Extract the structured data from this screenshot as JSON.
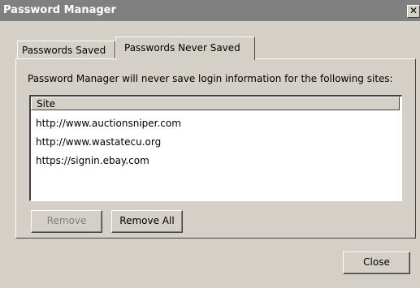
{
  "window": {
    "title": "Password Manager",
    "close_glyph": "✕"
  },
  "tabs": [
    {
      "label": "Passwords Saved",
      "selected": false
    },
    {
      "label": "Passwords Never Saved",
      "selected": true
    }
  ],
  "panel": {
    "description": "Password Manager will never save login information for the following sites:",
    "list": {
      "column_header": "Site",
      "rows": [
        "http://www.auctionsniper.com",
        "http://www.wastatecu.org",
        "https://signin.ebay.com"
      ]
    },
    "buttons": {
      "remove": {
        "label": "Remove",
        "enabled": false
      },
      "remove_all": {
        "label": "Remove All",
        "enabled": true
      }
    }
  },
  "footer": {
    "close_label": "Close"
  },
  "colors": {
    "dialog_bg": "#d4d0c8",
    "titlebar_bg": "#808080",
    "list_bg": "#ffffff"
  }
}
